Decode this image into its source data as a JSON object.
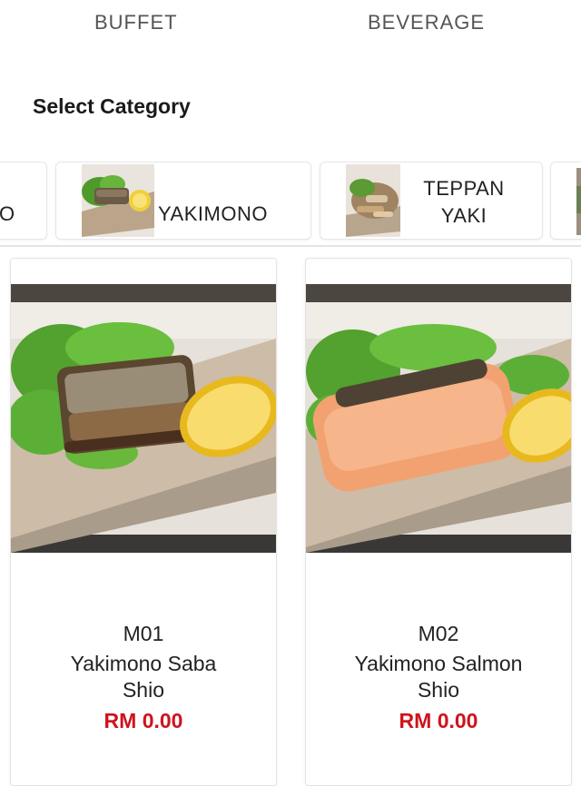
{
  "top_tabs": [
    {
      "label": "BUFFET"
    },
    {
      "label": "BEVERAGE"
    }
  ],
  "section_title": "Select Category",
  "categories": [
    {
      "label": "O"
    },
    {
      "label": "YAKIMONO"
    },
    {
      "label_line1": "TEPPAN",
      "label_line2": "YAKI"
    }
  ],
  "products": [
    {
      "code": "M01",
      "name_line1": "Yakimono Saba",
      "name_line2": "Shio",
      "price": "RM 0.00"
    },
    {
      "code": "M02",
      "name_line1": "Yakimono Salmon",
      "name_line2": "Shio",
      "price": "RM 0.00"
    }
  ],
  "colors": {
    "price": "#d0121b",
    "tab_text": "#555555",
    "border": "#e4e4e4"
  }
}
